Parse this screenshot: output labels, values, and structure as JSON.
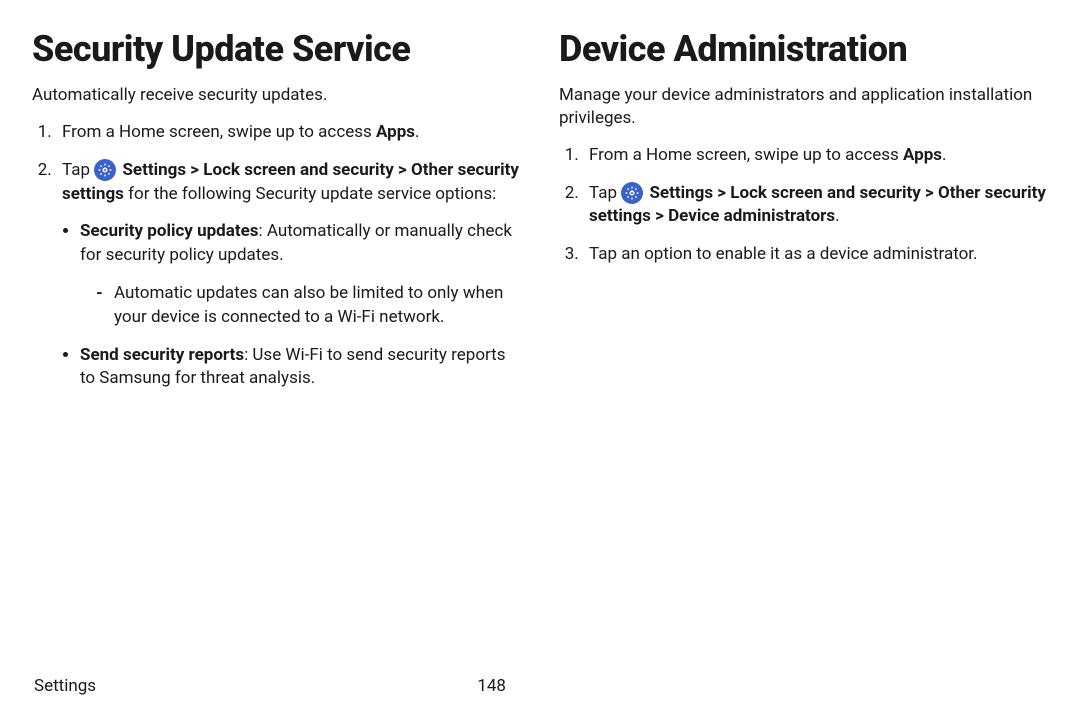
{
  "left": {
    "title": "Security Update Service",
    "intro": "Automatically receive security updates.",
    "step1_pre": "From a Home screen, swipe up to access ",
    "step1_b": "Apps",
    "step2_pre": "Tap ",
    "step2_b": "Settings > Lock screen and security > Other security settings",
    "step2_post": " for the following Security update service options:",
    "bullet1_b": "Security policy updates",
    "bullet1_post": ": Automatically or manually check for security policy updates.",
    "dash1": "Automatic updates can also be limited to only when your device is connected to a Wi-Fi network.",
    "bullet2_b": "Send security reports",
    "bullet2_post": ": Use Wi-Fi to send security reports to Samsung for threat analysis."
  },
  "right": {
    "title": "Device Administration",
    "intro": "Manage your device administrators and application installation privileges.",
    "step1_pre": "From a Home screen, swipe up to access ",
    "step1_b": "Apps",
    "step2_pre": "Tap ",
    "step2_b": "Settings > Lock screen and security > Other security settings > Device administrators",
    "step3": "Tap an option to enable it as a device administrator."
  },
  "footer": {
    "section": "Settings",
    "page": "148"
  }
}
